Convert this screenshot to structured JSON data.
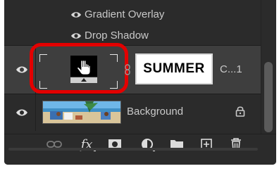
{
  "effects": [
    {
      "label": "Gradient Overlay"
    },
    {
      "label": "Drop Shadow"
    }
  ],
  "layers": [
    {
      "name": "SUMMER",
      "suffix": "C...1",
      "type": "smart-object",
      "selected": true,
      "visible": true,
      "highlighted": true
    },
    {
      "name": "Background",
      "type": "image",
      "locked": true,
      "visible": true
    }
  ],
  "toolbar": {
    "icons": [
      "link-layers-icon",
      "fx-icon",
      "layer-mask-icon",
      "adjustment-layer-icon",
      "group-folder-icon",
      "new-layer-icon",
      "trash-icon"
    ],
    "fx_label": "fx"
  },
  "colors": {
    "panel_bg": "#2b2b2b",
    "selected_row": "#3e3e3e",
    "highlight_outline": "#e30000",
    "text": "#c9c9c9"
  }
}
